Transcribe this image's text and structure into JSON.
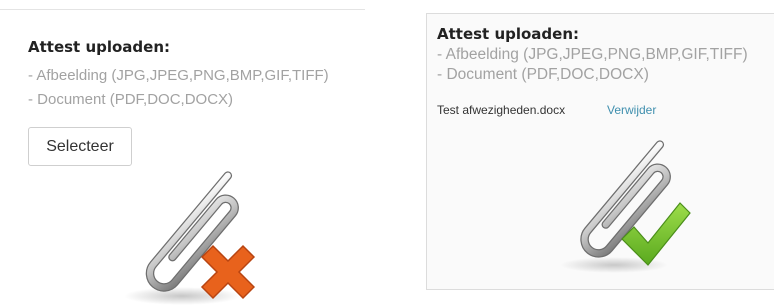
{
  "left_panel": {
    "title": "Attest uploaden:",
    "file_types": [
      "- Afbeelding (JPG,JPEG,PNG,BMP,GIF,TIFF)",
      "- Document (PDF,DOC,DOCX)"
    ],
    "select_button_label": "Selecteer",
    "status_icon": "paperclip-with-orange-x-icon",
    "status_color": "#e8621c"
  },
  "right_panel": {
    "title": "Attest uploaden:",
    "file_types": [
      "- Afbeelding (JPG,JPEG,PNG,BMP,GIF,TIFF)",
      "- Document (PDF,DOC,DOCX)"
    ],
    "uploaded_file_name": "Test afwezigheden.docx",
    "remove_link_label": "Verwijder",
    "link_color": "#3f8fae",
    "status_icon": "paperclip-with-green-check-icon",
    "status_color": "#6fbd2b"
  }
}
